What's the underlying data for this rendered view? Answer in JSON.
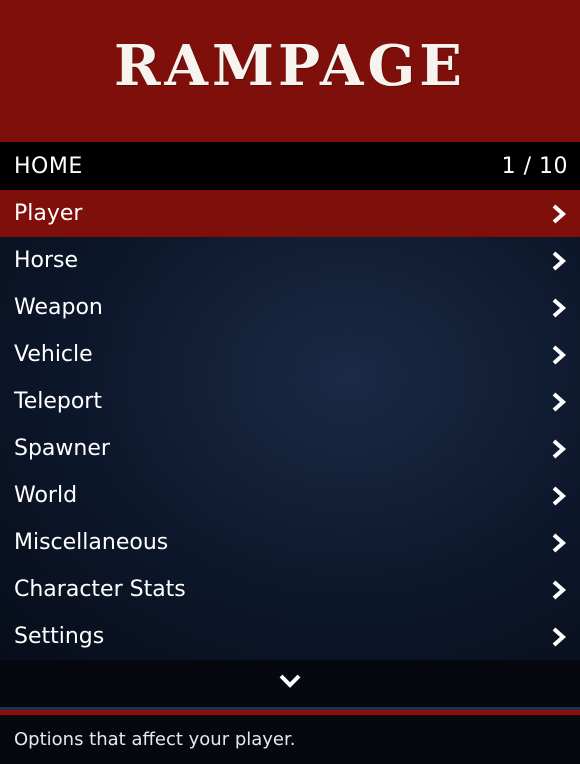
{
  "header": {
    "title": "RAMPAGE"
  },
  "subheader": {
    "section": "HOME",
    "page_indicator": "1 / 10"
  },
  "menu_items": [
    {
      "label": "Player",
      "icon": "chevron-right-icon",
      "selected": true
    },
    {
      "label": "Horse",
      "icon": "chevron-right-icon"
    },
    {
      "label": "Weapon",
      "icon": "chevron-right-icon"
    },
    {
      "label": "Vehicle",
      "icon": "chevron-right-icon"
    },
    {
      "label": "Teleport",
      "icon": "chevron-right-icon"
    },
    {
      "label": "Spawner",
      "icon": "chevron-right-icon"
    },
    {
      "label": "World",
      "icon": "chevron-right-icon"
    },
    {
      "label": "Miscellaneous",
      "icon": "chevron-right-icon"
    },
    {
      "label": "Character Stats",
      "icon": "chevron-right-icon"
    },
    {
      "label": "Settings",
      "icon": "chevron-right-icon"
    }
  ],
  "scroll": {
    "icon": "chevron-down-icon"
  },
  "footer": {
    "description": "Options that affect your player."
  },
  "colors": {
    "header_bg": "#7e0f0a",
    "selected_bg": "#7e0f0a",
    "subheader_bg": "#000000",
    "list_bg": "#0d172b",
    "footer_accent_blue": "#1c2f55",
    "footer_accent_red": "#8a0f0b"
  }
}
